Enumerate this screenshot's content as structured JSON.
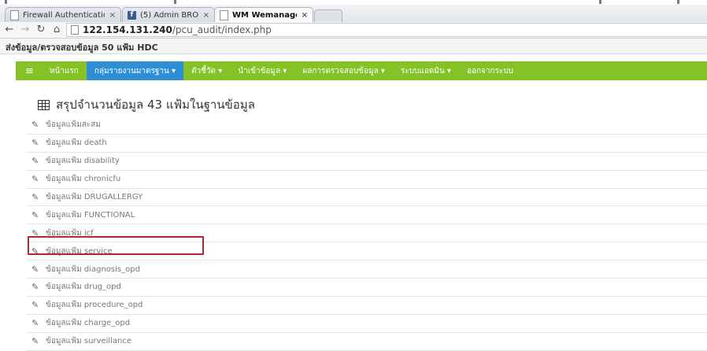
{
  "browser": {
    "tabs": [
      {
        "title": "Firewall Authentication",
        "icon": "page-icon"
      },
      {
        "title": "(5) Admin BRO",
        "icon": "facebook-icon"
      },
      {
        "title": "WM Wemanager",
        "icon": "page-icon"
      }
    ],
    "close_glyph": "×",
    "url_host": "122.154.131.240",
    "url_path": "/pcu_audit/index.php"
  },
  "site": {
    "title": "ส่งข้อมูล/ตรวจสอบข้อมูล 50 แฟ้ม HDC"
  },
  "menu": {
    "items": [
      {
        "label": "หน้าแรก"
      },
      {
        "label": "กลุ่มรายงานมาตรฐาน ▾"
      },
      {
        "label": "ตัวชี้วัด ▾"
      },
      {
        "label": "นำเข้าข้อมูล ▾"
      },
      {
        "label": "ผลการตรวจสอบข้อมูล ▾"
      },
      {
        "label": "ระบบแอดมิน ▾"
      },
      {
        "label": "ออกจากระบบ"
      }
    ],
    "active_index": 1,
    "colors": {
      "bar": "#84c226",
      "active": "#2f8fd6"
    }
  },
  "content": {
    "heading": "สรุปจำนวนข้อมูล 43 แฟ้มในฐานข้อมูล",
    "rows": [
      "ข้อมูลแฟ้มสะสม",
      "ข้อมูลแฟ้ม death",
      "ข้อมูลแฟ้ม disability",
      "ข้อมูลแฟ้ม chronicfu",
      "ข้อมูลแฟ้ม DRUGALLERGY",
      "ข้อมูลแฟ้ม FUNCTIONAL",
      "ข้อมูลแฟ้ม icf",
      "ข้อมูลแฟ้ม service",
      "ข้อมูลแฟ้ม diagnosis_opd",
      "ข้อมูลแฟ้ม drug_opd",
      "ข้อมูลแฟ้ม procedure_opd",
      "ข้อมูลแฟ้ม charge_opd",
      "ข้อมูลแฟ้ม surveillance"
    ],
    "highlighted_row": 7,
    "highlight_color": "#b8272d"
  }
}
